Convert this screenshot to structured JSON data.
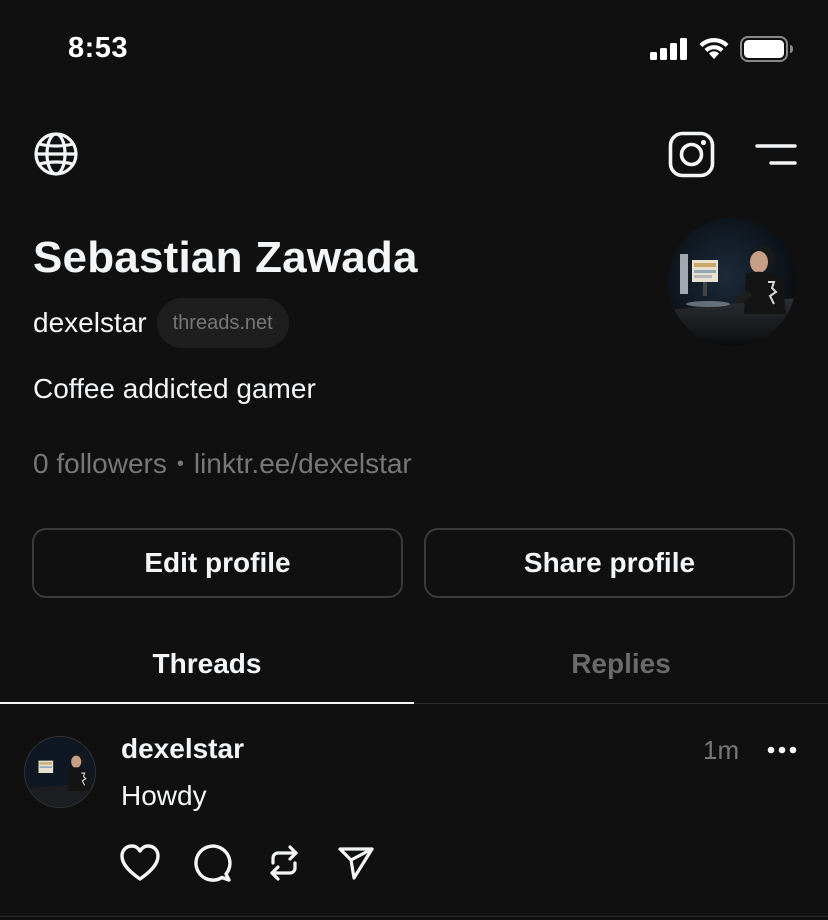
{
  "status_bar": {
    "time": "8:53"
  },
  "nav": {
    "globe_icon": "globe-icon",
    "instagram_icon": "instagram-icon",
    "menu_icon": "menu-icon"
  },
  "profile": {
    "name": "Sebastian Zawada",
    "handle": "dexelstar",
    "domain_badge": "threads.net",
    "bio": "Coffee addicted gamer",
    "followers": "0 followers",
    "separator": "•",
    "link": "linktr.ee/dexelstar"
  },
  "buttons": {
    "edit": "Edit profile",
    "share": "Share profile"
  },
  "tabs": [
    {
      "label": "Threads",
      "active": true
    },
    {
      "label": "Replies",
      "active": false
    }
  ],
  "post": {
    "username": "dexelstar",
    "time": "1m",
    "text": "Howdy",
    "actions": [
      "heart-icon",
      "comment-icon",
      "repost-icon",
      "send-icon"
    ]
  },
  "colors": {
    "background": "#101010",
    "text_primary": "#f3f5f7",
    "text_secondary": "#777777",
    "border": "#3a3a3a"
  }
}
